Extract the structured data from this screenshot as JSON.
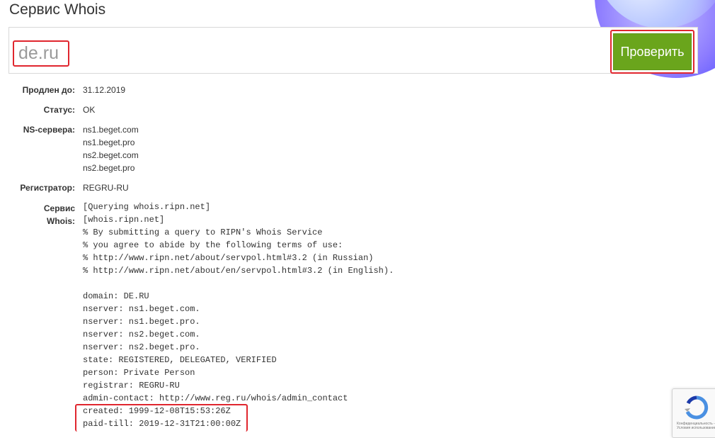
{
  "page": {
    "title": "Сервис Whois"
  },
  "search": {
    "value": "de.ru",
    "button_label": "Проверить"
  },
  "info": {
    "paid_label": "Продлен до:",
    "paid_value": "31.12.2019",
    "status_label": "Статус:",
    "status_value": "OK",
    "ns_label": "NS-сервера:",
    "ns_values": [
      "ns1.beget.com",
      "ns1.beget.pro",
      "ns2.beget.com",
      "ns2.beget.pro"
    ],
    "registrar_label": "Регистратор:",
    "registrar_value": "REGRU-RU",
    "whois_label_line1": "Сервис",
    "whois_label_line2": "Whois:"
  },
  "whois_lines": [
    "[Querying whois.ripn.net]",
    "[whois.ripn.net]",
    "% By submitting a query to RIPN's Whois Service",
    "% you agree to abide by the following terms of use:",
    "% http://www.ripn.net/about/servpol.html#3.2 (in Russian)",
    "% http://www.ripn.net/about/en/servpol.html#3.2 (in English).",
    "",
    "domain: DE.RU",
    "nserver: ns1.beget.com.",
    "nserver: ns1.beget.pro.",
    "nserver: ns2.beget.com.",
    "nserver: ns2.beget.pro.",
    "state: REGISTERED, DELEGATED, VERIFIED",
    "person: Private Person",
    "registrar: REGRU-RU",
    "admin-contact: http://www.reg.ru/whois/admin_contact",
    "created: 1999-12-08T15:53:26Z",
    "paid-till: 2019-12-31T21:00:00Z"
  ],
  "recaptcha": {
    "text": "Конфиденциальность - Условия использования"
  },
  "colors": {
    "button_green": "#6aa51c",
    "highlight_red": "#e0262e"
  }
}
